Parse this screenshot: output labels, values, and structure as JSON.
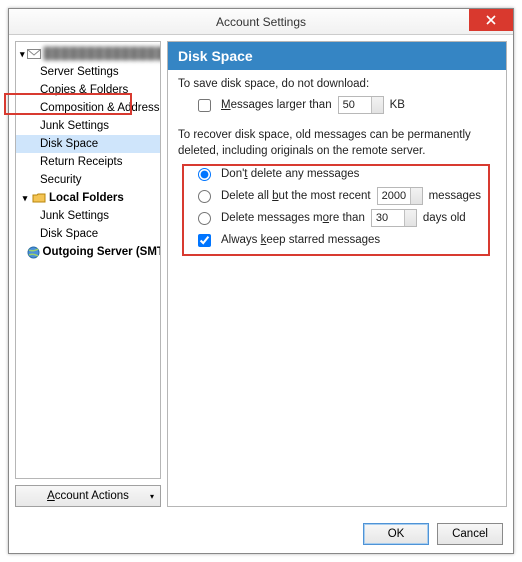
{
  "window": {
    "title": "Account Settings"
  },
  "sidebar": {
    "account_name": "████████████████",
    "items": [
      {
        "label": "Server Settings"
      },
      {
        "label": "Copies & Folders"
      },
      {
        "label": "Composition & Addressing"
      },
      {
        "label": "Junk Settings"
      },
      {
        "label": "Disk Space",
        "selected": true
      },
      {
        "label": "Return Receipts"
      },
      {
        "label": "Security"
      }
    ],
    "local_folders": {
      "label": "Local Folders",
      "children": [
        {
          "label": "Junk Settings"
        },
        {
          "label": "Disk Space"
        }
      ]
    },
    "smtp": {
      "label": "Outgoing Server (SMTP)"
    },
    "actions_label": "Account Actions"
  },
  "content": {
    "header": "Disk Space",
    "save_text": "To save disk space, do not download:",
    "cb_larger": {
      "label_pre": "M",
      "label_post": "essages larger than",
      "checked": false
    },
    "size_value": "50",
    "size_unit": "KB",
    "recover_text": "To recover disk space, old messages can be permanently deleted, including originals on the remote server.",
    "radio": {
      "none": {
        "label_pre": "Don'",
        "u": "t",
        "label_post": " delete any messages",
        "checked": true
      },
      "recent": {
        "label_pre": "Delete all ",
        "u": "b",
        "label_post": "ut the most recent",
        "count": "2000",
        "unit": "messages",
        "checked": false
      },
      "older": {
        "label_pre": "Delete messages m",
        "u": "o",
        "label_post": "re than",
        "days": "30",
        "unit": "days old",
        "checked": false
      }
    },
    "cb_starred": {
      "label_pre": "Always ",
      "u": "k",
      "label_post": "eep starred messages",
      "checked": true
    }
  },
  "footer": {
    "ok": "OK",
    "cancel": "Cancel"
  }
}
